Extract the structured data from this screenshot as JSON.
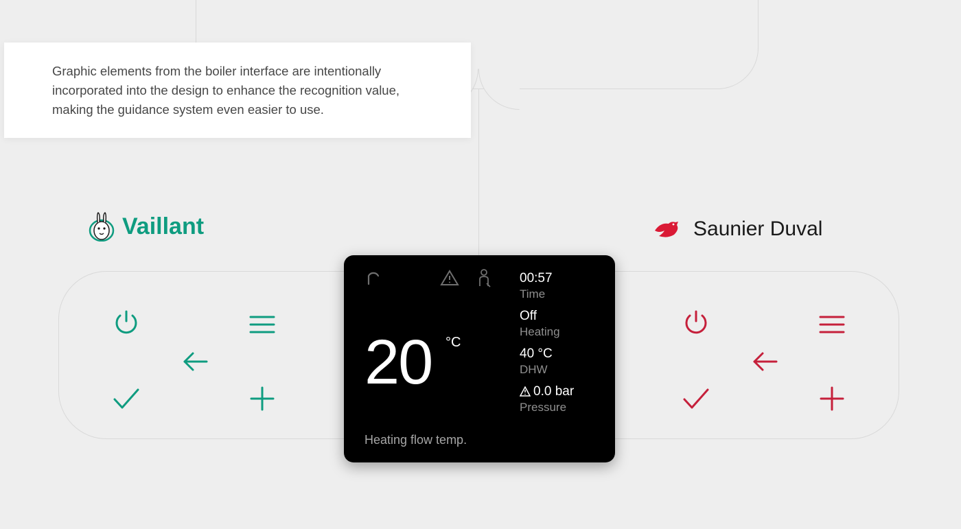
{
  "callout": {
    "text": "Graphic elements from the boiler interface are intentionally incorporated into the design to enhance the recognition value, making the guidance system even easier to use."
  },
  "brands": {
    "vaillant": {
      "name": "Vaillant",
      "color": "#0f9c80"
    },
    "saunier": {
      "name": "Saunier Duval",
      "color": "#c5203b"
    }
  },
  "controls": {
    "power_label": "power",
    "menu_label": "menu",
    "back_label": "back",
    "confirm_label": "confirm",
    "add_label": "add"
  },
  "device": {
    "main_temp_value": "20",
    "main_temp_unit": "°C",
    "main_label": "Heating flow temp.",
    "side": [
      {
        "value": "00:57",
        "label": "Time"
      },
      {
        "value": "Off",
        "label": "Heating"
      },
      {
        "value": "40 °C",
        "label": "DHW"
      },
      {
        "value": "0.0 bar",
        "label": "Pressure",
        "warning": true
      }
    ]
  }
}
